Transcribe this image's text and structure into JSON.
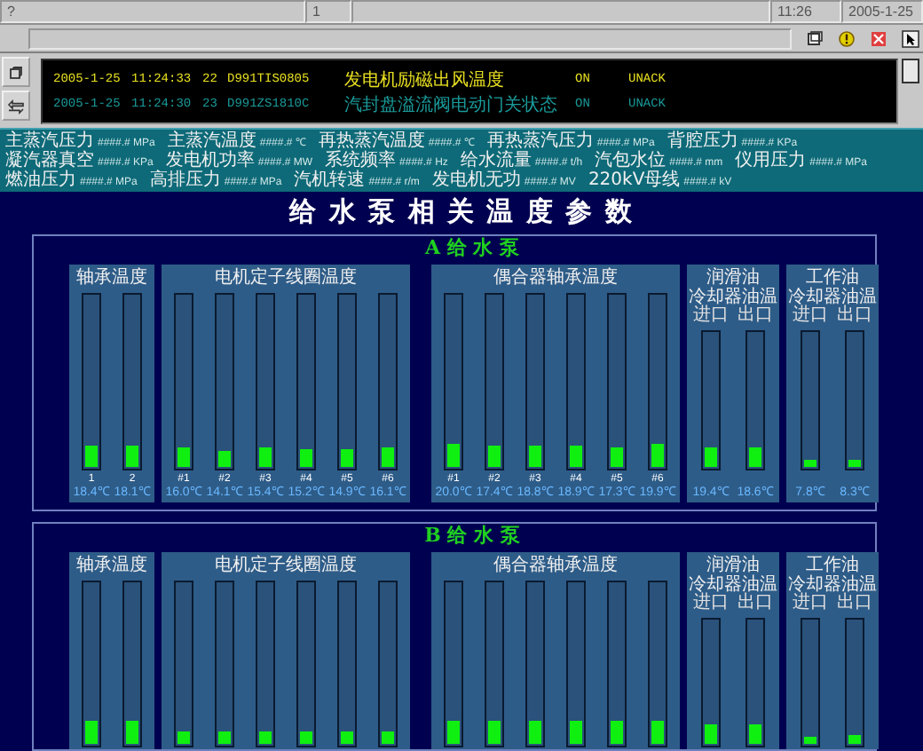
{
  "toolbar": {
    "help": "?",
    "page": "1",
    "time": "11:26",
    "date": "2005-1-25"
  },
  "alarms": [
    {
      "date": "2005-1-25",
      "time": "11:24:33",
      "seq": "22",
      "tag": "D991TIS0805",
      "desc": "发电机励磁出风温度",
      "state": "ON",
      "ack": "UNACK",
      "color": "#e8e020"
    },
    {
      "date": "2005-1-25",
      "time": "11:24:30",
      "seq": "23",
      "tag": "D991ZS1810C",
      "desc": "汽封盘溢流阀电动门关状态",
      "state": "ON",
      "ack": "UNACK",
      "color": "#1a9a9a"
    }
  ],
  "status": [
    {
      "label": "主蒸汽压力",
      "value": "####.#",
      "unit": "MPa"
    },
    {
      "label": "主蒸汽温度",
      "value": "####.#",
      "unit": "℃"
    },
    {
      "label": "再热蒸汽温度",
      "value": "####.#",
      "unit": "℃"
    },
    {
      "label": "再热蒸汽压力",
      "value": "####.#",
      "unit": "MPa"
    },
    {
      "label": "背腔压力",
      "value": "####.#",
      "unit": "KPa"
    },
    {
      "label": "凝汽器真空",
      "value": "####.#",
      "unit": "KPa"
    },
    {
      "label": "发电机功率",
      "value": "####.#",
      "unit": "MW"
    },
    {
      "label": "系统频率",
      "value": "####.#",
      "unit": "Hz"
    },
    {
      "label": "给水流量",
      "value": "####.#",
      "unit": "t/h"
    },
    {
      "label": "汽包水位",
      "value": "####.#",
      "unit": "mm"
    },
    {
      "label": "仪用压力",
      "value": "####.#",
      "unit": "MPa"
    },
    {
      "label": "燃油压力",
      "value": "####.#",
      "unit": "MPa"
    },
    {
      "label": "高排压力",
      "value": "####.#",
      "unit": "MPa"
    },
    {
      "label": "汽机转速",
      "value": "####.#",
      "unit": "r/m"
    },
    {
      "label": "发电机无功",
      "value": "####.#",
      "unit": "MV"
    },
    {
      "label": "220kV母线",
      "value": "####.#",
      "unit": "kV"
    }
  ],
  "title": "给 水 泵 相 关 温 度 参 数",
  "sections": [
    {
      "header": "A 给 水 泵",
      "groups": [
        {
          "title": [
            "轴承温度"
          ],
          "bars": [
            {
              "label": "1",
              "value": "18.4℃",
              "level": 0.13
            },
            {
              "label": "2",
              "value": "18.1℃",
              "level": 0.13
            }
          ]
        },
        {
          "title": [
            "电机定子线圈温度"
          ],
          "bars": [
            {
              "label": "#1",
              "value": "16.0℃",
              "level": 0.11
            },
            {
              "label": "#2",
              "value": "14.1℃",
              "level": 0.09
            },
            {
              "label": "#3",
              "value": "15.4℃",
              "level": 0.11
            },
            {
              "label": "#4",
              "value": "15.2℃",
              "level": 0.1
            },
            {
              "label": "#5",
              "value": "14.9℃",
              "level": 0.1
            },
            {
              "label": "#6",
              "value": "16.1℃",
              "level": 0.11
            }
          ]
        },
        {
          "title": [
            "偶合器轴承温度"
          ],
          "bars": [
            {
              "label": "#1",
              "value": "20.0℃",
              "level": 0.14
            },
            {
              "label": "#2",
              "value": "17.4℃",
              "level": 0.12
            },
            {
              "label": "#3",
              "value": "18.8℃",
              "level": 0.13
            },
            {
              "label": "#4",
              "value": "18.9℃",
              "level": 0.12
            },
            {
              "label": "#5",
              "value": "17.3℃",
              "level": 0.11
            },
            {
              "label": "#6",
              "value": "19.9℃",
              "level": 0.14
            }
          ]
        },
        {
          "title": [
            "润滑油",
            "冷却器油温"
          ],
          "ports": [
            "进口",
            "出口"
          ],
          "bars": [
            {
              "value": "19.4℃",
              "level": 0.15
            },
            {
              "value": "18.6℃",
              "level": 0.15
            }
          ]
        },
        {
          "title": [
            "工作油",
            "冷却器油温"
          ],
          "ports": [
            "进口",
            "出口"
          ],
          "bars": [
            {
              "value": "7.8℃",
              "level": 0.06
            },
            {
              "value": "8.3℃",
              "level": 0.06
            }
          ]
        }
      ]
    },
    {
      "header": "B 给 水 泵",
      "groups": [
        {
          "title": [
            "轴承温度"
          ],
          "bars": [
            {
              "level": 0.14
            },
            {
              "level": 0.14
            }
          ]
        },
        {
          "title": [
            "电机定子线圈温度"
          ],
          "bars": [
            {
              "level": 0.08
            },
            {
              "level": 0.08
            },
            {
              "level": 0.08
            },
            {
              "level": 0.08
            },
            {
              "level": 0.08
            },
            {
              "level": 0.08
            }
          ]
        },
        {
          "title": [
            "偶合器轴承温度"
          ],
          "bars": [
            {
              "level": 0.15
            },
            {
              "level": 0.15
            },
            {
              "level": 0.14
            },
            {
              "level": 0.14
            },
            {
              "level": 0.14
            },
            {
              "level": 0.15
            }
          ]
        },
        {
          "title": [
            "润滑油",
            "冷却器油温"
          ],
          "ports": [
            "进口",
            "出口"
          ],
          "bars": [
            {
              "level": 0.16
            },
            {
              "level": 0.16
            }
          ]
        },
        {
          "title": [
            "工作油",
            "冷却器油温"
          ],
          "ports": [
            "进口",
            "出口"
          ],
          "bars": [
            {
              "level": 0.06
            },
            {
              "level": 0.07
            }
          ]
        }
      ]
    }
  ]
}
